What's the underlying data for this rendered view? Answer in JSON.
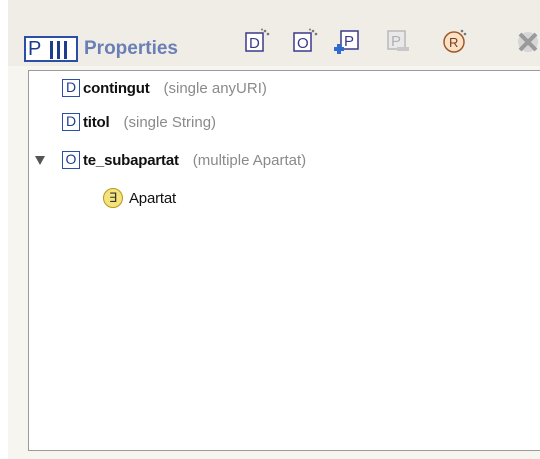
{
  "header": {
    "badge_letter": "P",
    "title": "Properties"
  },
  "toolbar": [
    {
      "name": "create-datatype-property-button",
      "glyph": "D"
    },
    {
      "name": "create-object-property-button",
      "glyph": "O"
    },
    {
      "name": "add-property-button",
      "glyph": "P"
    },
    {
      "name": "remove-property-button",
      "glyph": "P"
    },
    {
      "name": "create-restriction-button",
      "glyph": "R"
    },
    {
      "name": "delete-button",
      "glyph": "X"
    }
  ],
  "tree": {
    "items": [
      {
        "icon": "D",
        "name": "contingut",
        "type": "(single anyURI)"
      },
      {
        "icon": "D",
        "name": "titol",
        "type": "(single String)"
      },
      {
        "icon": "O",
        "name": "te_subapartat",
        "type": "(multiple Apartat)"
      }
    ],
    "child": {
      "icon": "∃",
      "name": "Apartat"
    }
  },
  "colors": {
    "accent": "#2b4fa5",
    "title": "#6a7fb5",
    "type_text": "#8a8a8a"
  }
}
